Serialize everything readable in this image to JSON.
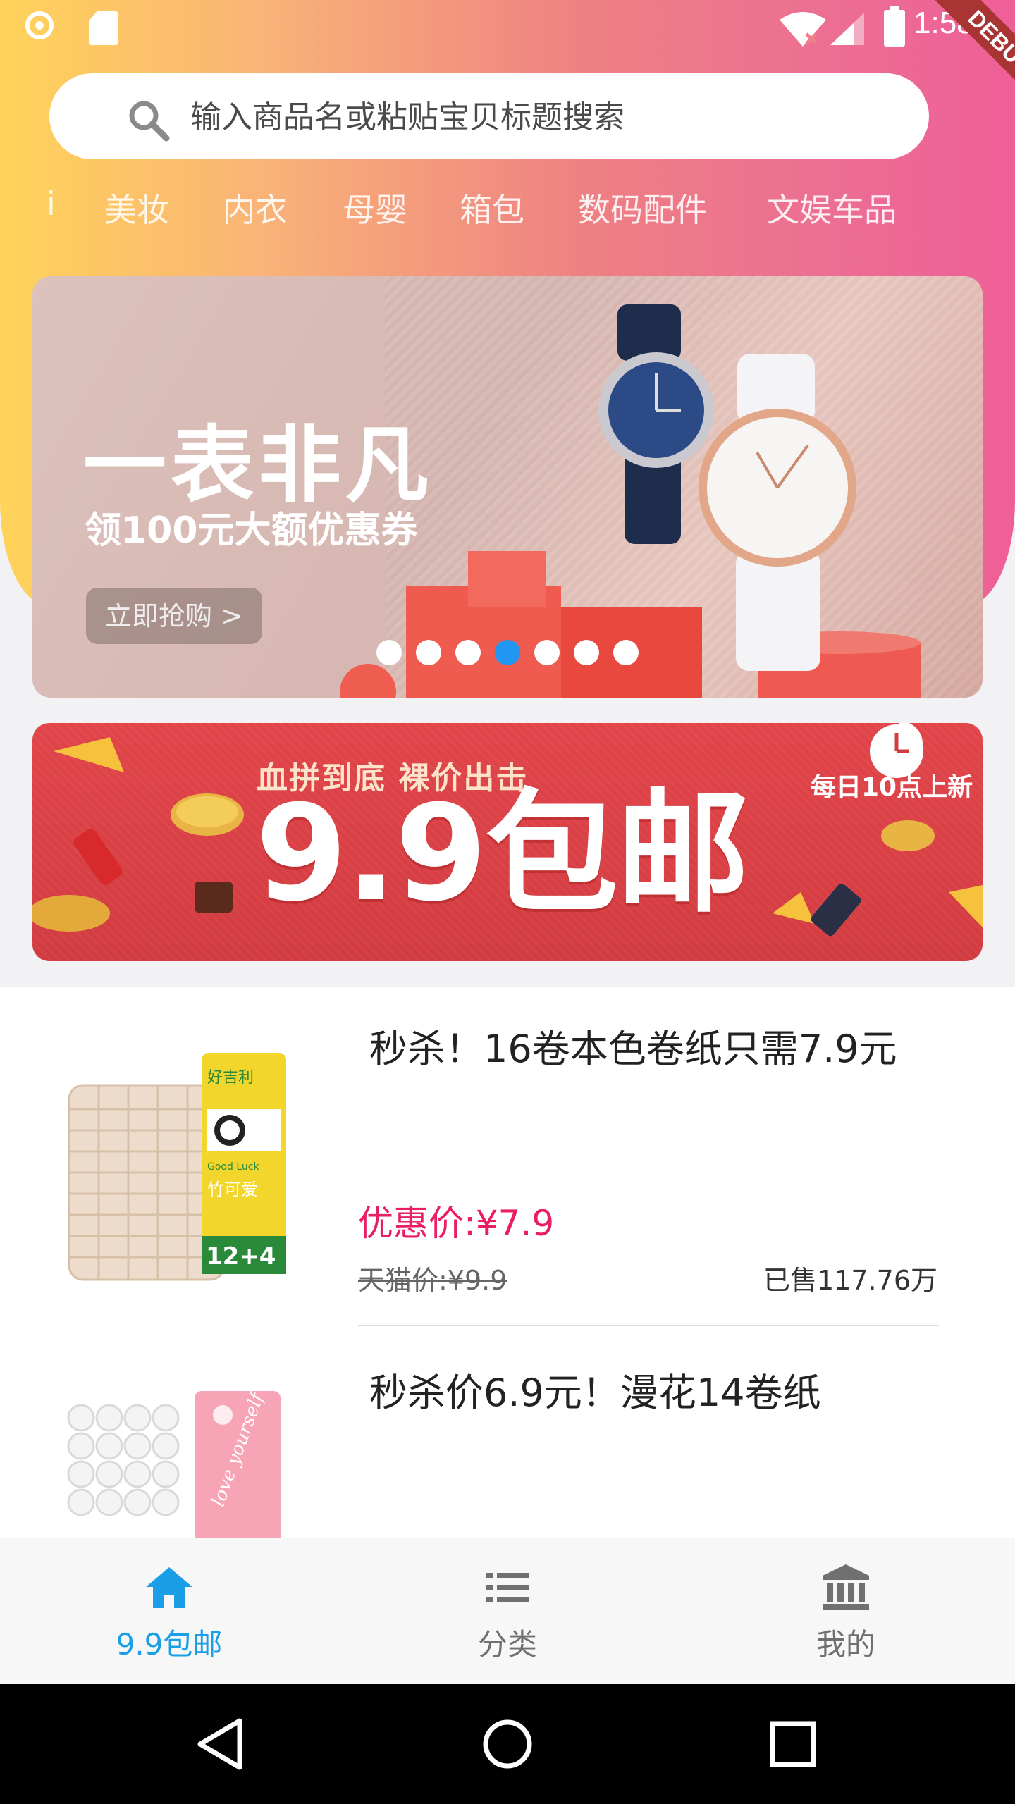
{
  "status_bar": {
    "time": "1:58",
    "debug_label": "DEBUG"
  },
  "search": {
    "placeholder": "输入商品名或粘贴宝贝标题搜索"
  },
  "category_tabs": [
    "i",
    "美妆",
    "内衣",
    "母婴",
    "箱包",
    "数码配件",
    "文娱车品"
  ],
  "carousel": {
    "title": "一表非凡",
    "subtitle": "领100元大额优惠券",
    "button_label": "立即抢购 >",
    "page_count": 7,
    "active_index": 3
  },
  "promo": {
    "subtitle": "血拼到底 裸价出击",
    "main": "9.9包邮",
    "tag": "每日10点上新"
  },
  "products": [
    {
      "title": "秒杀！16卷本色卷纸只需7.9元",
      "price": "优惠价:¥7.9",
      "original": "天猫价:¥9.9",
      "sold": "已售117.76万",
      "image_text": [
        "好吉利",
        "Good Luck",
        "竹可爱",
        "12+4"
      ]
    },
    {
      "title": "秒杀价6.9元！漫花14卷纸",
      "image_text": [
        "love yourself"
      ]
    }
  ],
  "bottom_nav": [
    {
      "label": "9.9包邮",
      "icon": "home-icon",
      "active": true
    },
    {
      "label": "分类",
      "icon": "list-icon",
      "active": false
    },
    {
      "label": "我的",
      "icon": "bank-icon",
      "active": false
    }
  ],
  "colors": {
    "accent": "#2196f3",
    "price": "#e91e63",
    "nav_active": "#1a9fe6"
  }
}
